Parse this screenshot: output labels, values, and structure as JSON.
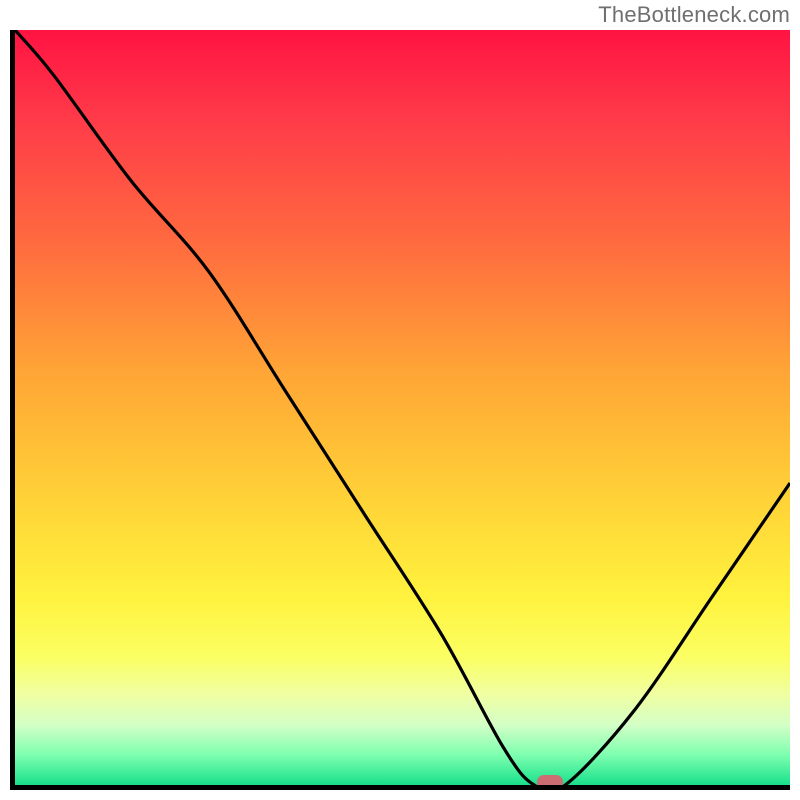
{
  "watermark": "TheBottleneck.com",
  "chart_data": {
    "type": "line",
    "title": "",
    "xlabel": "",
    "ylabel": "",
    "xlim": [
      0,
      100
    ],
    "ylim": [
      0,
      100
    ],
    "grid": false,
    "legend": false,
    "series": [
      {
        "name": "curve",
        "x": [
          0,
          5,
          15,
          25,
          35,
          45,
          55,
          63,
          67,
          71,
          80,
          90,
          100
        ],
        "y": [
          100,
          94,
          80,
          68,
          52,
          36,
          20,
          5,
          0,
          0,
          10,
          25,
          40
        ]
      }
    ],
    "marker": {
      "x": 69,
      "y": 0,
      "color": "#cc6d73"
    },
    "background_bands": [
      {
        "range": [
          0,
          4
        ],
        "color": "#18e08b"
      },
      {
        "range": [
          4,
          8
        ],
        "color": "#7effb0"
      },
      {
        "range": [
          8,
          12
        ],
        "color": "#d4ffc6"
      },
      {
        "range": [
          12,
          17
        ],
        "color": "#f0ffa2"
      },
      {
        "range": [
          17,
          25
        ],
        "color": "#fbff62"
      },
      {
        "range": [
          25,
          38
        ],
        "color": "#fff23e"
      },
      {
        "range": [
          38,
          55
        ],
        "color": "#ffd237"
      },
      {
        "range": [
          55,
          72
        ],
        "color": "#ffa436"
      },
      {
        "range": [
          72,
          88
        ],
        "color": "#ff6a3f"
      },
      {
        "range": [
          88,
          100
        ],
        "color": "#ff1342"
      }
    ]
  }
}
